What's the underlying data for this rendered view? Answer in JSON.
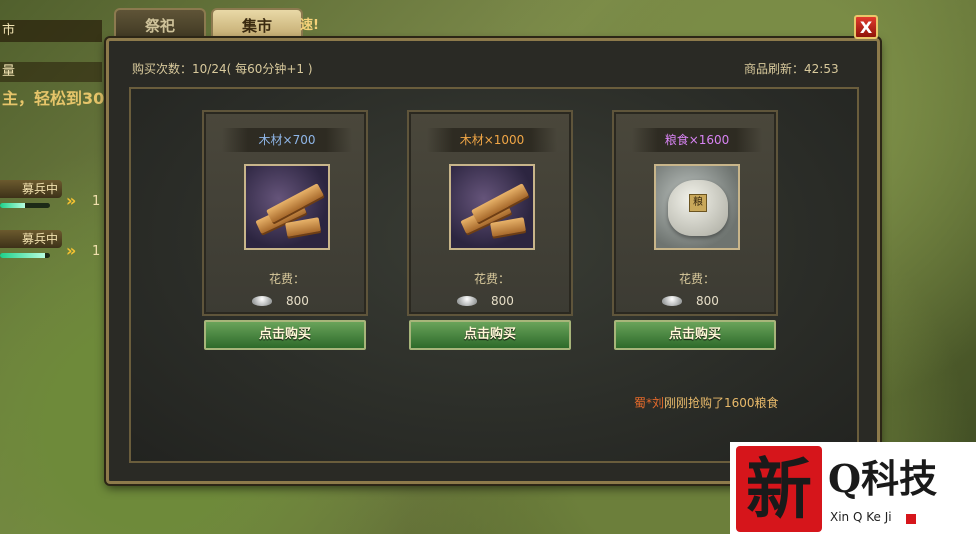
{
  "background": {
    "hud_line1": "市",
    "hud_line2": "量",
    "hud_line3": "主，轻松到30",
    "recruit_items": [
      {
        "label": "募兵中",
        "progress": 0.5,
        "count": "1"
      },
      {
        "label": "募兵中",
        "progress": 0.9,
        "count": "1"
      }
    ],
    "tab_extra": "速!"
  },
  "tabs": [
    {
      "label": "祭祀",
      "active": false
    },
    {
      "label": "集市",
      "active": true
    }
  ],
  "close_label": "X",
  "header": {
    "buy_count_label": "购买次数：",
    "buy_count_value": "10/24",
    "buy_count_rule": "( 每60分钟+1 )",
    "refresh_label": "商品刷新：",
    "refresh_time": "42:53"
  },
  "items": [
    {
      "name": "木材×700",
      "name_color": "#8fb6e8",
      "icon": "wood-icon",
      "cost_label": "花费：",
      "currency_icon": "silver-ingot-icon",
      "price": "800",
      "buy_label": "点击购买"
    },
    {
      "name": "木材×1000",
      "name_color": "#f0a646",
      "icon": "wood-icon",
      "cost_label": "花费：",
      "currency_icon": "silver-ingot-icon",
      "price": "800",
      "buy_label": "点击购买"
    },
    {
      "name": "粮食×1600",
      "name_color": "#d783f2",
      "icon": "grain-sack-icon",
      "sack_tag": "粮",
      "cost_label": "花费：",
      "currency_icon": "silver-ingot-icon",
      "price": "800",
      "buy_label": "点击购买"
    }
  ],
  "notice": {
    "who": "蜀*刘",
    "text": "刚刚抢购了1600粮食"
  },
  "watermark": {
    "seal_char": "新",
    "brand": "Q科技",
    "subtitle": "Xin Q Ke Ji"
  }
}
